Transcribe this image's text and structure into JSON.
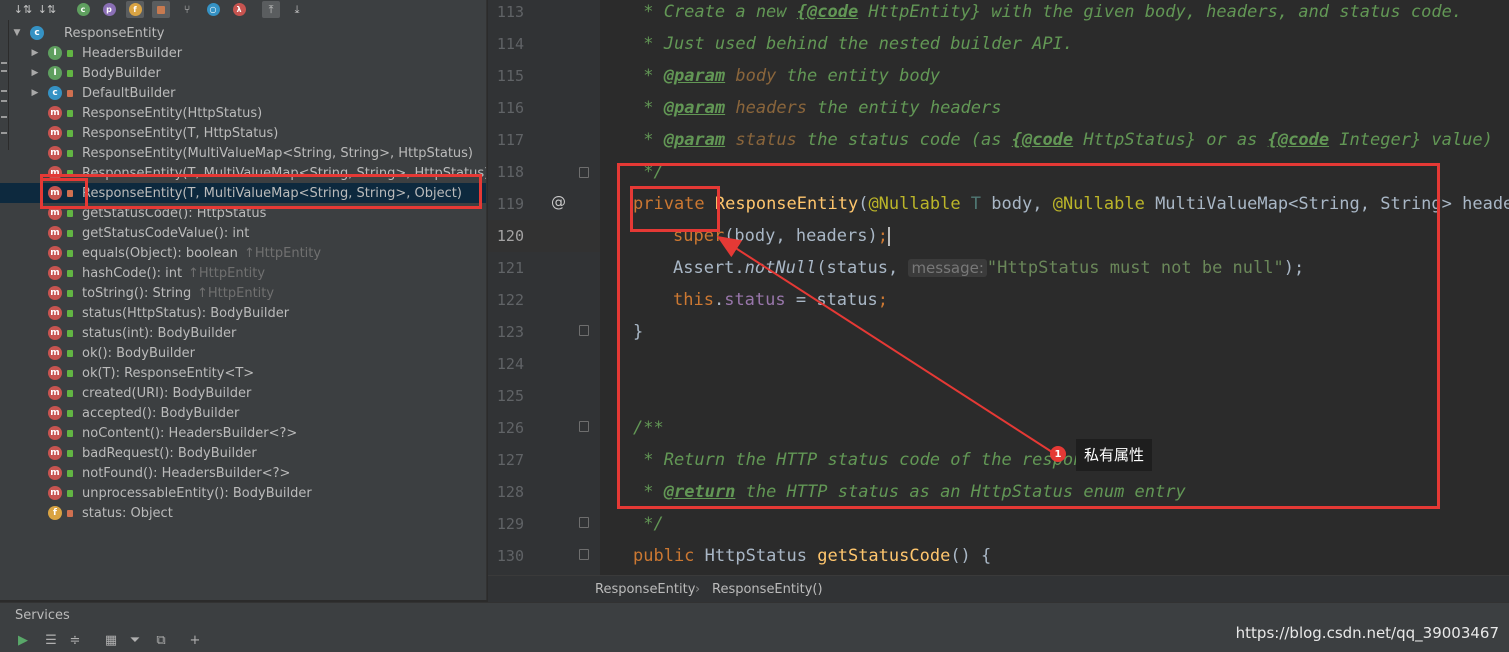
{
  "structure": {
    "toolbar_icons": [
      "sort-alpha-icon",
      "sort-visibility-icon",
      "show-inherited-icon",
      "show-properties-icon",
      "show-fields-icon",
      "show-non-public-icon",
      "show-lambdas-icon",
      "show-anonymous-icon",
      "show-lambda-icon",
      "autoscroll-to-source-icon",
      "autoscroll-from-source-icon"
    ],
    "root": "ResponseEntity",
    "items": [
      {
        "label": "HeadersBuilder",
        "kind": "interface",
        "inherited": ""
      },
      {
        "label": "BodyBuilder",
        "kind": "interface",
        "inherited": ""
      },
      {
        "label": "DefaultBuilder",
        "kind": "class",
        "inherited": ""
      },
      {
        "label": "ResponseEntity(HttpStatus)",
        "kind": "method",
        "inherited": ""
      },
      {
        "label": "ResponseEntity(T, HttpStatus)",
        "kind": "method",
        "inherited": ""
      },
      {
        "label": "ResponseEntity(MultiValueMap<String, String>, HttpStatus)",
        "kind": "method",
        "inherited": ""
      },
      {
        "label": "ResponseEntity(T, MultiValueMap<String, String>, HttpStatus)",
        "kind": "method",
        "inherited": ""
      },
      {
        "label": "ResponseEntity(T, MultiValueMap<String, String>, Object)",
        "kind": "method",
        "inherited": ""
      },
      {
        "label": "getStatusCode(): HttpStatus",
        "kind": "method",
        "inherited": ""
      },
      {
        "label": "getStatusCodeValue(): int",
        "kind": "method",
        "inherited": ""
      },
      {
        "label": "equals(Object): boolean",
        "kind": "method",
        "inherited": "↑HttpEntity"
      },
      {
        "label": "hashCode(): int",
        "kind": "method",
        "inherited": "↑HttpEntity"
      },
      {
        "label": "toString(): String",
        "kind": "method",
        "inherited": "↑HttpEntity"
      },
      {
        "label": "status(HttpStatus): BodyBuilder",
        "kind": "method",
        "inherited": ""
      },
      {
        "label": "status(int): BodyBuilder",
        "kind": "method",
        "inherited": ""
      },
      {
        "label": "ok(): BodyBuilder",
        "kind": "method",
        "inherited": ""
      },
      {
        "label": "ok(T): ResponseEntity<T>",
        "kind": "method",
        "inherited": ""
      },
      {
        "label": "created(URI): BodyBuilder",
        "kind": "method",
        "inherited": ""
      },
      {
        "label": "accepted(): BodyBuilder",
        "kind": "method",
        "inherited": ""
      },
      {
        "label": "noContent(): HeadersBuilder<?>",
        "kind": "method",
        "inherited": ""
      },
      {
        "label": "badRequest(): BodyBuilder",
        "kind": "method",
        "inherited": ""
      },
      {
        "label": "notFound(): HeadersBuilder<?>",
        "kind": "method",
        "inherited": ""
      },
      {
        "label": "unprocessableEntity(): BodyBuilder",
        "kind": "method",
        "inherited": ""
      },
      {
        "label": "status: Object",
        "kind": "field",
        "inherited": ""
      }
    ],
    "selected_index": 7
  },
  "editor": {
    "line_numbers": [
      "113",
      "114",
      "115",
      "116",
      "117",
      "118",
      "119",
      "120",
      "121",
      "122",
      "123",
      "124",
      "125",
      "126",
      "127",
      "128",
      "129",
      "130"
    ],
    "current_line": "120",
    "gutter_mark": "@",
    "lines": {
      "l113": {
        "a": " * Create a new ",
        "b": "{@code",
        "c": " HttpEntity}",
        "d": " with the given body, headers, and status code."
      },
      "l114": {
        "a": " * Just used behind the nested builder API."
      },
      "l115": {
        "a": " * ",
        "b": "@param",
        "c": " body",
        "d": " the entity body"
      },
      "l116": {
        "a": " * ",
        "b": "@param",
        "c": " headers",
        "d": " the entity headers"
      },
      "l117": {
        "a": " * ",
        "b": "@param",
        "c": " status",
        "d": " the status code (as ",
        "e": "{@code",
        "f": " HttpStatus}",
        "g": " or as ",
        "h": "{@code",
        "i": " Integer}",
        "j": " value)"
      },
      "l118": {
        "a": " */"
      },
      "l119": {
        "kw": "private ",
        "fn": "ResponseEntity",
        "p1": "(",
        "an1": "@Nullable",
        "gn": " T",
        "p2": " body, ",
        "an2": "@Nullable",
        "p3": " MultiValueMap<String, String> headers"
      },
      "l120": {
        "kw": "super",
        "p": "(body, headers)",
        "semi": ";"
      },
      "l121": {
        "p1": "Assert.",
        "it": "notNull",
        "p2": "(status, ",
        "hint": "message:",
        "st": "\"HttpStatus must not be null\"",
        "p3": ");"
      },
      "l122": {
        "kw": "this",
        "p1": ".",
        "fd": "status",
        "p2": " = status",
        "semi": ";"
      },
      "l123": {
        "p": "}"
      },
      "l126": {
        "a": "/**"
      },
      "l127": {
        "a": " * Return the HTTP status code of the response."
      },
      "l128": {
        "a": " * ",
        "b": "@return",
        "c": " the HTTP status as an HttpStatus enum entry"
      },
      "l129": {
        "a": " */"
      },
      "l130": {
        "kw": "public ",
        "ty": "HttpStatus ",
        "fn": "getStatusCode",
        "p": "() {"
      }
    }
  },
  "breadcrumb": {
    "first": "ResponseEntity",
    "second": "ResponseEntity()"
  },
  "services": {
    "title": "Services"
  },
  "annotation": {
    "badge": "1",
    "label": "私有属性"
  },
  "watermark": "https://blog.csdn.net/qq_39003467",
  "colors": {
    "annotation_red": "#e53935",
    "selection": "#0d293e",
    "comment_green": "#629755",
    "keyword_orange": "#cc7832"
  }
}
